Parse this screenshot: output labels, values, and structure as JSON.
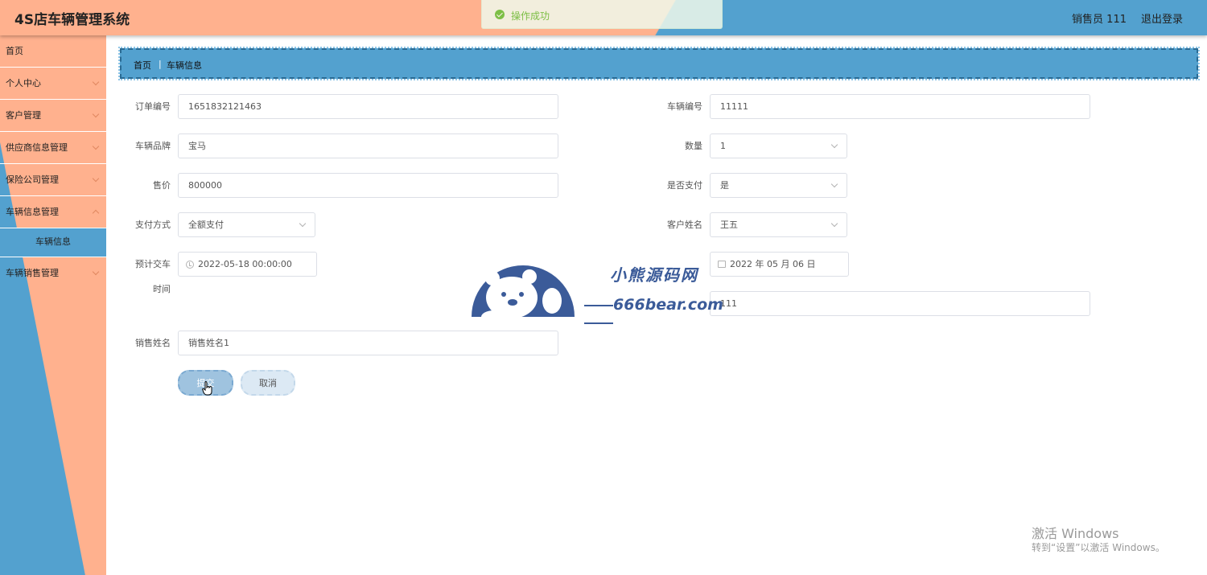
{
  "app": {
    "title": "4S店车辆管理系统",
    "user": "销售员 111",
    "logout": "退出登录"
  },
  "toast": {
    "message": "操作成功"
  },
  "sidebar": {
    "items": [
      {
        "label": "首页"
      },
      {
        "label": "个人中心"
      },
      {
        "label": "客户管理"
      },
      {
        "label": "供应商信息管理"
      },
      {
        "label": "保险公司管理"
      },
      {
        "label": "车辆信息管理"
      },
      {
        "label": "车辆信息"
      },
      {
        "label": "车辆销售管理"
      }
    ]
  },
  "breadcrumb": {
    "home": "首页",
    "separator": "|",
    "current": "车辆信息"
  },
  "form": {
    "order_no": {
      "label": "订单编号",
      "value": "1651832121463"
    },
    "vehicle_no": {
      "label": "车辆编号",
      "value": "11111"
    },
    "brand": {
      "label": "车辆品牌",
      "value": "宝马"
    },
    "quantity": {
      "label": "数量",
      "value": "1"
    },
    "price": {
      "label": "售价",
      "value": "800000"
    },
    "paid": {
      "label": "是否支付",
      "value": "是"
    },
    "pay_method": {
      "label": "支付方式",
      "value": "全额支付"
    },
    "customer_name": {
      "label": "客户姓名",
      "value": "王五"
    },
    "delivery_time": {
      "label_1": "预计交车",
      "label_2": "时间",
      "value": "2022-05-18 00:00:00"
    },
    "date": {
      "value": "2022 年 05 月 06 日"
    },
    "field8": {
      "value": "111"
    },
    "sales_name": {
      "label": "销售姓名",
      "value": "销售姓名1"
    },
    "submit": "提交",
    "cancel": "取消"
  },
  "watermark": {
    "title": "小熊源码网",
    "subtitle": "666bear.com"
  },
  "windows": {
    "line1": "激活 Windows",
    "line2": "转到“设置”以激活 Windows。"
  },
  "colors": {
    "accent_orange": "#ffb18e",
    "accent_blue": "#53a1cf",
    "success": "#67c23a"
  }
}
